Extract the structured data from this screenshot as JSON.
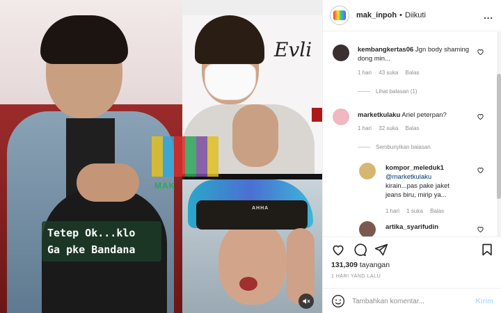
{
  "post": {
    "caption_line1": "Tetep Ok...klo",
    "caption_line2": "Ga pke Bandana",
    "banner_text": "Evli",
    "bandana_text": "AHHA",
    "watermark_text": "MAK",
    "watermark_colors": [
      "#e0c024",
      "#31a8d8",
      "#d2302e",
      "#2da65a",
      "#7b4ea0",
      "#e0c024"
    ]
  },
  "header": {
    "username": "mak_inpoh",
    "separator": "•",
    "follow_label": "Diikuti",
    "more_label": "..."
  },
  "comments": [
    {
      "username": "kembangkertas06",
      "text": "Jgn body shaming dong min...",
      "time": "1 hari",
      "likes": "43 suka",
      "reply": "Balas",
      "avatar_color": "#3a3030",
      "thread_label": "Lihat balasan (1)"
    },
    {
      "username": "marketkulaku",
      "text": "Ariel peterpan?",
      "time": "1 hari",
      "likes": "32 suka",
      "reply": "Balas",
      "avatar_color": "#f0b8c0",
      "thread_label": "Sembunyikan balasan"
    },
    {
      "username": "kompor_meleduk1",
      "mention": "@marketkulaku",
      "text_line1": "kirain...pas pake jaket",
      "text_line2": "jeans biru, mirip ya...",
      "time": "1 hari",
      "likes": "1 suka",
      "reply": "Balas",
      "avatar_color": "#d6b670"
    },
    {
      "username": "artika_syarifudin",
      "avatar_color": "#7a5a50"
    }
  ],
  "actions": {
    "views_count": "131,309",
    "views_label": "tayangan",
    "timestamp": "1 HARI YANG LALU",
    "comment_placeholder": "Tambahkan komentar...",
    "post_label": "Kirim"
  },
  "colors": {
    "link_disabled": "#b2dffc",
    "muted_text": "#8e8e8e",
    "border": "#efefef"
  }
}
